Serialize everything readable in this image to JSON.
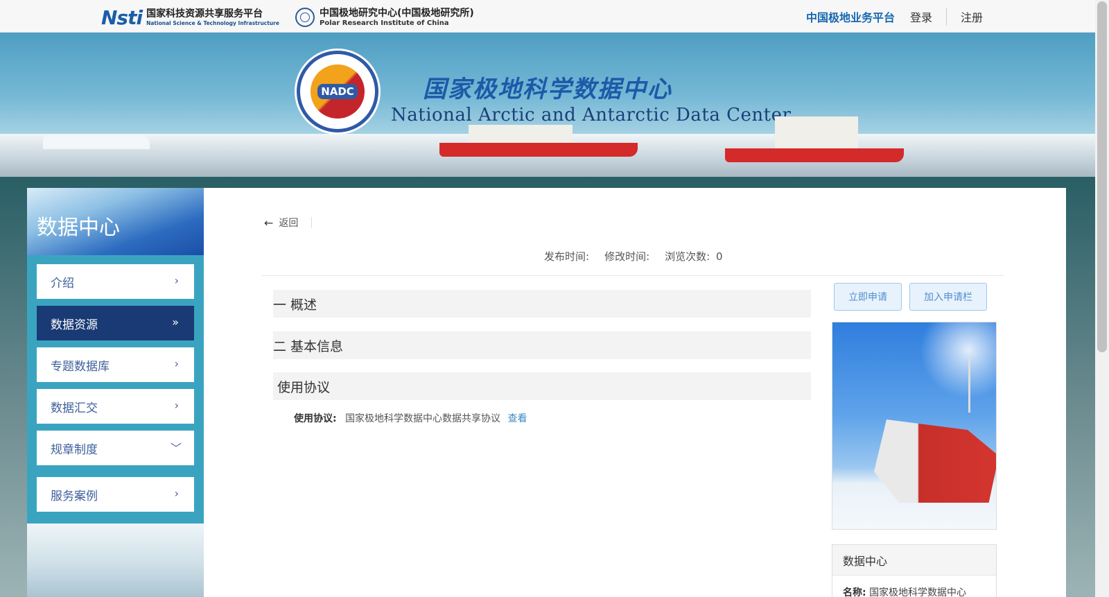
{
  "topbar": {
    "logo1": {
      "mark": "Nsti",
      "cn": "国家科技资源共享服务平台",
      "en": "National Science & Technology Infrastructure"
    },
    "logo2": {
      "cn": "中国极地研究中心(中国极地研究所)",
      "en": "Polar Research Institute of China"
    },
    "links": {
      "platform": "中国极地业务平台",
      "login": "登录",
      "register": "注册"
    }
  },
  "banner": {
    "seal_label": "NADC",
    "title_cn": "国家极地科学数据中心",
    "title_en": "National Arctic and Antarctic Data Center"
  },
  "sidebar": {
    "title": "数据中心",
    "items": [
      {
        "label": "介绍",
        "chevron": "›"
      },
      {
        "label": "数据资源",
        "chevron": "»"
      },
      {
        "label": "专题数据库",
        "chevron": "›"
      },
      {
        "label": "数据汇交",
        "chevron": "›"
      },
      {
        "label": "规章制度",
        "chevron": "﹀"
      },
      {
        "label": "服务案例",
        "chevron": "›"
      }
    ]
  },
  "main": {
    "back_label": "返回",
    "meta": {
      "published": "发布时间:",
      "modified": "修改时间:",
      "views": "浏览次数:",
      "views_count": "0"
    },
    "sections": [
      "一 概述",
      "二 基本信息",
      "使用协议"
    ],
    "agreement": {
      "label": "使用协议:",
      "value": "国家极地科学数据中心数据共享协议",
      "link": "查看"
    },
    "buttons": {
      "apply": "立即申请",
      "cart": "加入申请栏"
    },
    "info_box": {
      "title": "数据中心",
      "name_label": "名称:",
      "name_value": "国家极地科学数据中心"
    }
  }
}
